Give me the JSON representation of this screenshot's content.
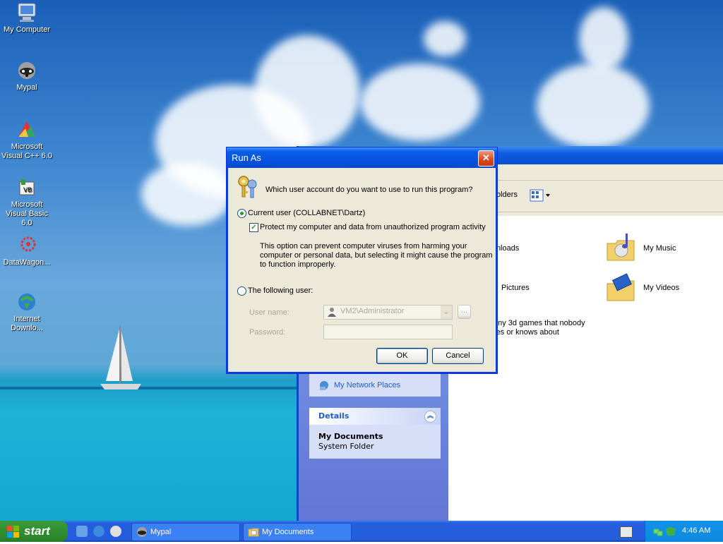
{
  "desktop": {
    "icons": [
      {
        "label": "My Computer",
        "icon": "computer-icon"
      },
      {
        "label": "Mypal",
        "icon": "raccoon-icon"
      },
      {
        "label": "Microsoft Visual C++ 6.0",
        "icon": "visual-cpp-icon"
      },
      {
        "label": "Microsoft Visual Basic 6.0",
        "icon": "visual-basic-icon"
      },
      {
        "label": "DataWagon...",
        "icon": "datawagon-icon"
      },
      {
        "label": "Internet Downlo...",
        "icon": "internet-download-icon"
      }
    ]
  },
  "explorer": {
    "toolbar_folders": "olders",
    "items": [
      {
        "label": "wnloads"
      },
      {
        "label": "My Music",
        "icon": "music-folder-icon"
      },
      {
        "label": "Pictures"
      },
      {
        "label": "My Videos",
        "icon": "videos-folder-icon"
      },
      {
        "label": "nny 3d games that nobody"
      },
      {
        "label": "res or knows about"
      }
    ],
    "other_places_item": "My Network Places",
    "details": {
      "header": "Details",
      "name": "My Documents",
      "type": "System Folder"
    }
  },
  "runas": {
    "title": "Run As",
    "question": "Which user account do you want to use to run this program?",
    "current_user_label": "Current user (COLLABNET\\Dartz)",
    "protect_label": "Protect my computer and data from unauthorized program activity",
    "protect_note_1": "This option can prevent computer viruses from harming your",
    "protect_note_2": "computer or personal data, but selecting it might cause the program",
    "protect_note_3": "to function improperly.",
    "following_user_label": "The following user:",
    "username_label": "User name:",
    "username_value": "VM2\\Administrator",
    "browse_label": "...",
    "password_label": "Password:",
    "ok_label": "OK",
    "cancel_label": "Cancel",
    "close_label": "✕"
  },
  "taskbar": {
    "start_label": "start",
    "tasks": [
      {
        "label": "Mypal"
      },
      {
        "label": "My Documents"
      }
    ],
    "clock": "4:46 AM"
  }
}
